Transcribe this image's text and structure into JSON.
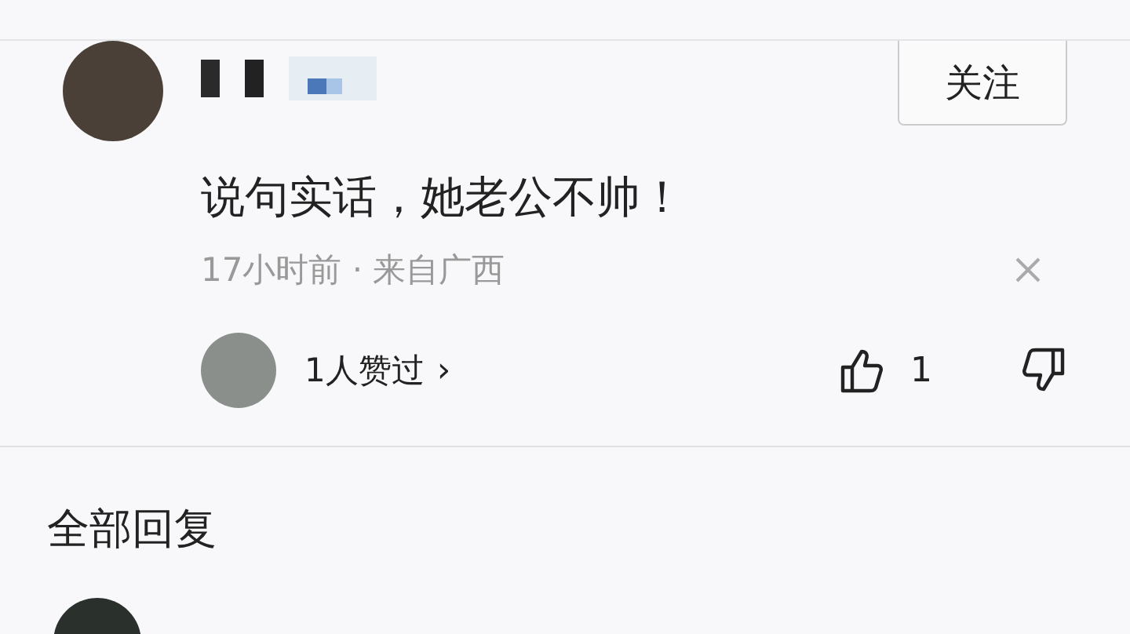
{
  "comment": {
    "follow_button": "关注",
    "text": "说句实话，她老公不帅！",
    "meta": "17小时前 · 来自广西",
    "likers": "1人赞过",
    "likers_chevron": "›",
    "like_count": "1"
  },
  "replies": {
    "title": "全部回复"
  }
}
